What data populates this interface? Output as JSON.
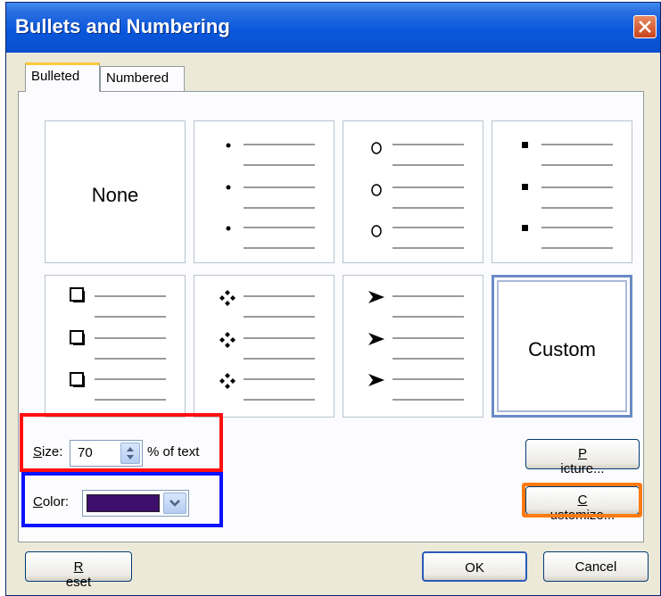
{
  "window": {
    "title": "Bullets and Numbering"
  },
  "tabs": [
    {
      "label": "Bulleted",
      "active": true
    },
    {
      "label": "Numbered",
      "active": false
    }
  ],
  "gallery": [
    {
      "kind": "none",
      "label": "None"
    },
    {
      "kind": "dot"
    },
    {
      "kind": "circle",
      "glyph": "o"
    },
    {
      "kind": "square"
    },
    {
      "kind": "checkbox"
    },
    {
      "kind": "four-diamond"
    },
    {
      "kind": "arrowhead"
    },
    {
      "kind": "custom",
      "label": "Custom",
      "selected": true
    }
  ],
  "size": {
    "label_prefix": "S",
    "label_rest": "ize:",
    "value": "70",
    "suffix": "% of text"
  },
  "color": {
    "label_prefix": "C",
    "label_rest": "olor:",
    "value": "#3d0e6b"
  },
  "buttons": {
    "picture": {
      "prefix": "P",
      "rest": "icture..."
    },
    "customize": {
      "prefix": "C",
      "rest": "ustomize..."
    },
    "reset": {
      "prefix": "R",
      "rest": "eset"
    },
    "ok": "OK",
    "cancel": "Cancel"
  },
  "highlights": {
    "size_box": "#ff1010",
    "color_box": "#0a12ff",
    "customize_box": "#ff7a10"
  }
}
